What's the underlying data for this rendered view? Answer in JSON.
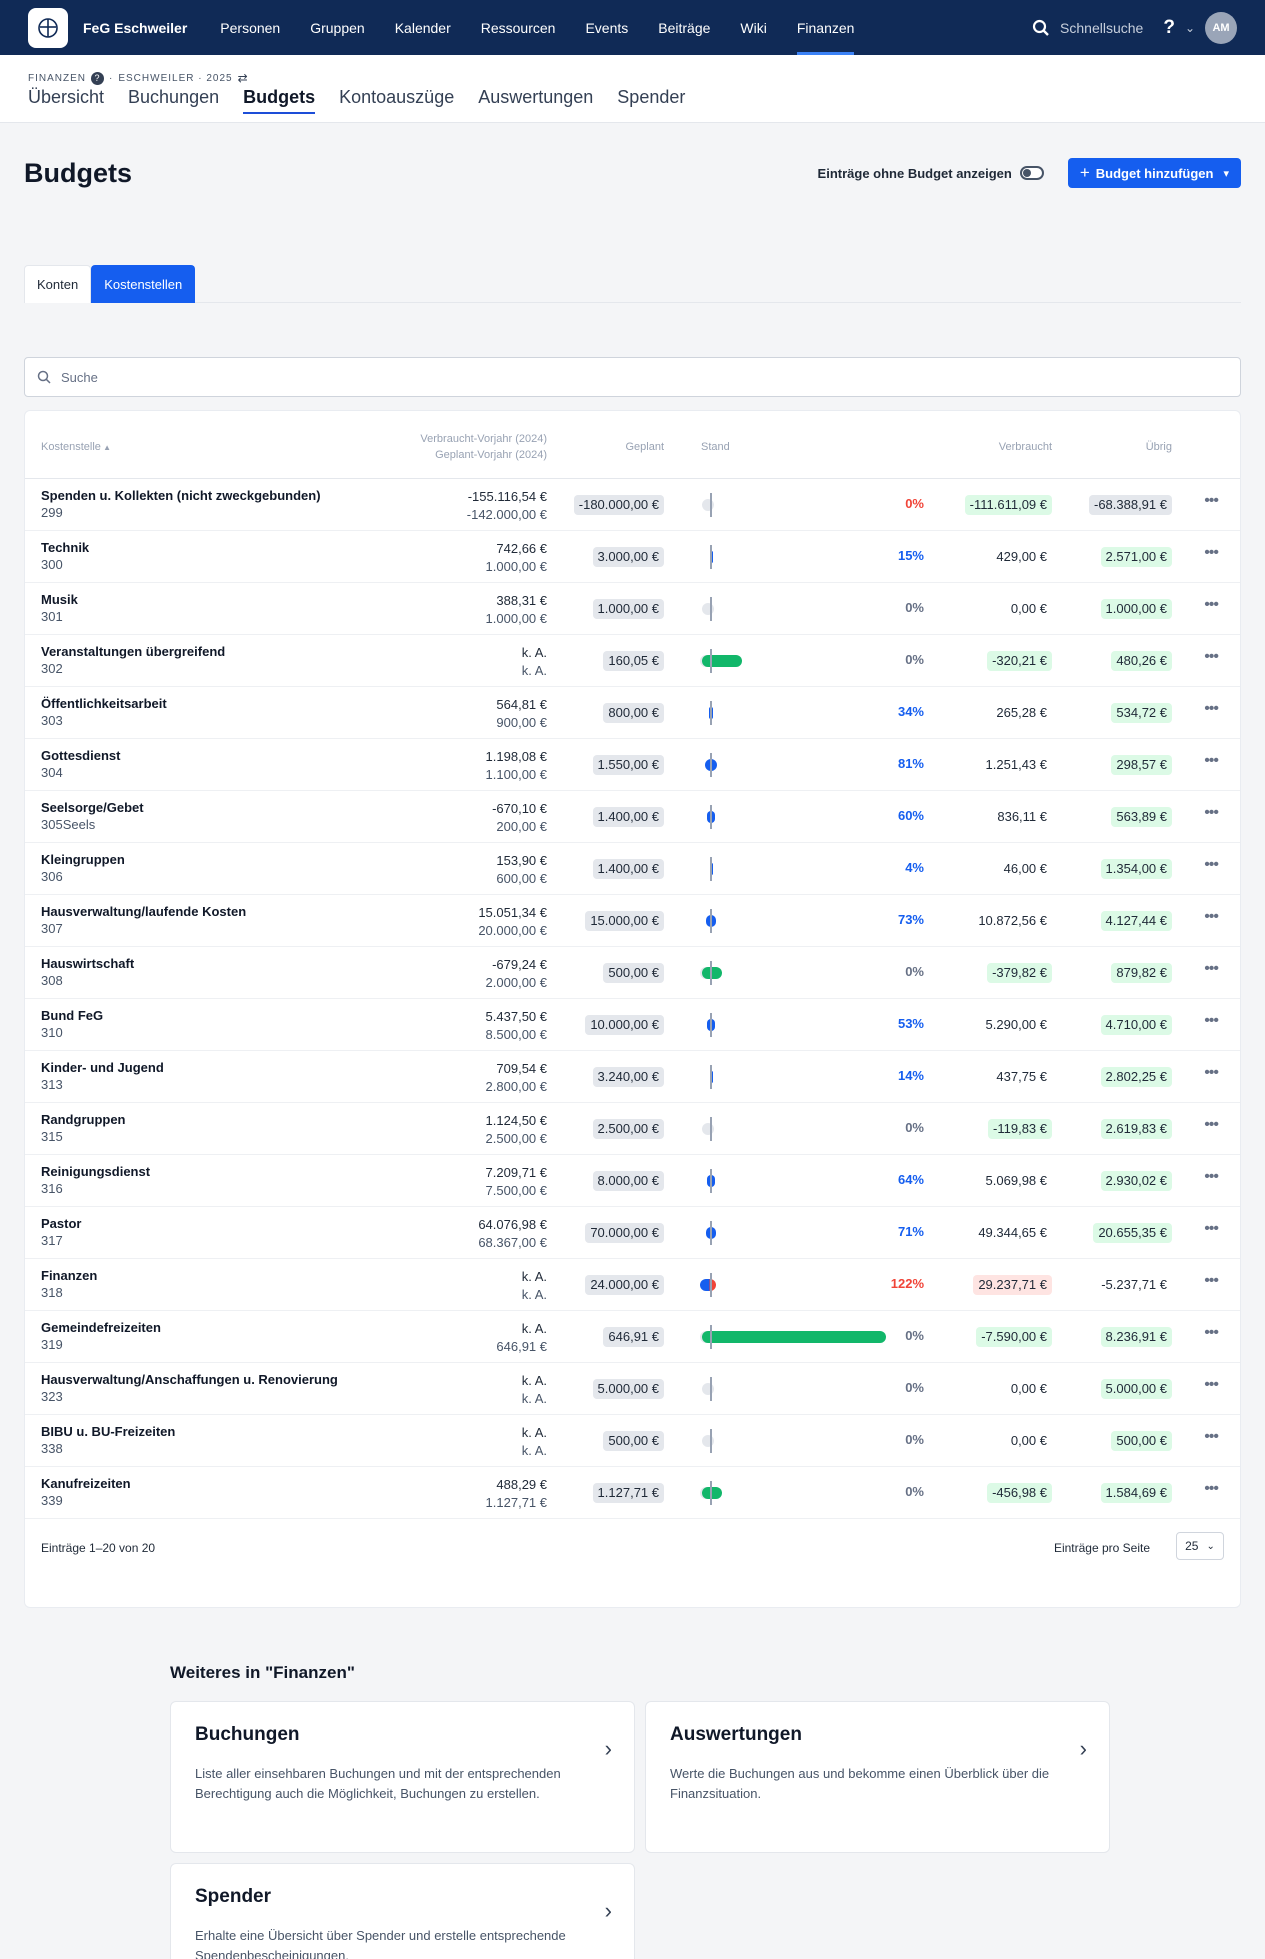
{
  "nav": {
    "brand": "FeG Eschweiler",
    "items": [
      "Personen",
      "Gruppen",
      "Kalender",
      "Ressourcen",
      "Events",
      "Beiträge",
      "Wiki",
      "Finanzen"
    ],
    "active": "Finanzen",
    "search_label": "Schnellsuche",
    "help": "?",
    "avatar": "AM"
  },
  "breadcrumb": {
    "section": "FINANZEN",
    "context": "ESCHWEILER · 2025"
  },
  "subtabs": [
    "Übersicht",
    "Buchungen",
    "Budgets",
    "Kontoauszüge",
    "Auswertungen",
    "Spender"
  ],
  "page": {
    "title": "Budgets",
    "toggle_label": "Einträge ohne Budget anzeigen",
    "add_button": "Budget hinzufügen"
  },
  "view_tabs": {
    "konten": "Konten",
    "kostenstellen": "Kostenstellen"
  },
  "search": {
    "placeholder": "Suche"
  },
  "table": {
    "headers": {
      "name": "Kostenstelle",
      "prev_used": "Verbraucht-Vorjahr (2024)",
      "prev_planned": "Geplant-Vorjahr (2024)",
      "planned": "Geplant",
      "status": "Stand",
      "used": "Verbraucht",
      "remaining": "Übrig"
    },
    "rows": [
      {
        "name": "Spenden u. Kollekten (nicht zweckgebunden)",
        "num": "299",
        "prev_used": "-155.116,54 €",
        "prev_planned": "-142.000,00 €",
        "planned": "-180.000,00 €",
        "pct": "0%",
        "pct_color": "red",
        "used": "-111.611,09 €",
        "used_style": "green",
        "rest": "-68.388,91 €",
        "rest_style": "gray",
        "bar": {
          "kind": "none",
          "value": 0
        }
      },
      {
        "name": "Technik",
        "num": "300",
        "prev_used": "742,66 €",
        "prev_planned": "1.000,00 €",
        "planned": "3.000,00 €",
        "pct": "15%",
        "pct_color": "blue",
        "used": "429,00 €",
        "used_style": "none",
        "rest": "2.571,00 €",
        "rest_style": "green",
        "bar": {
          "kind": "blue",
          "value": 0.15
        }
      },
      {
        "name": "Musik",
        "num": "301",
        "prev_used": "388,31 €",
        "prev_planned": "1.000,00 €",
        "planned": "1.000,00 €",
        "pct": "0%",
        "pct_color": "gray",
        "used": "0,00 €",
        "used_style": "none",
        "rest": "1.000,00 €",
        "rest_style": "green",
        "bar": {
          "kind": "none",
          "value": 0
        }
      },
      {
        "name": "Veranstaltungen übergreifend",
        "num": "302",
        "prev_used": "k. A.",
        "prev_planned": "k. A.",
        "planned": "160,05 €",
        "pct": "0%",
        "pct_color": "gray",
        "used": "-320,21 €",
        "used_style": "green",
        "rest": "480,26 €",
        "rest_style": "green",
        "bar": {
          "kind": "green",
          "value": 0.17
        }
      },
      {
        "name": "Öffentlichkeitsarbeit",
        "num": "303",
        "prev_used": "564,81 €",
        "prev_planned": "900,00 €",
        "planned": "800,00 €",
        "pct": "34%",
        "pct_color": "blue",
        "used": "265,28 €",
        "used_style": "none",
        "rest": "534,72 €",
        "rest_style": "green",
        "bar": {
          "kind": "blue",
          "value": 0.34
        }
      },
      {
        "name": "Gottesdienst",
        "num": "304",
        "prev_used": "1.198,08 €",
        "prev_planned": "1.100,00 €",
        "planned": "1.550,00 €",
        "pct": "81%",
        "pct_color": "blue",
        "used": "1.251,43 €",
        "used_style": "none",
        "rest": "298,57 €",
        "rest_style": "green",
        "bar": {
          "kind": "blue",
          "value": 0.81
        }
      },
      {
        "name": "Seelsorge/Gebet",
        "num": "305Seels",
        "prev_used": "-670,10 €",
        "prev_planned": "200,00 €",
        "planned": "1.400,00 €",
        "pct": "60%",
        "pct_color": "blue",
        "used": "836,11 €",
        "used_style": "none",
        "rest": "563,89 €",
        "rest_style": "green",
        "bar": {
          "kind": "blue",
          "value": 0.6
        }
      },
      {
        "name": "Kleingruppen",
        "num": "306",
        "prev_used": "153,90 €",
        "prev_planned": "600,00 €",
        "planned": "1.400,00 €",
        "pct": "4%",
        "pct_color": "blue",
        "used": "46,00 €",
        "used_style": "none",
        "rest": "1.354,00 €",
        "rest_style": "green",
        "bar": {
          "kind": "blue",
          "value": 0.04
        }
      },
      {
        "name": "Hausverwaltung/laufende Kosten",
        "num": "307",
        "prev_used": "15.051,34 €",
        "prev_planned": "20.000,00 €",
        "planned": "15.000,00 €",
        "pct": "73%",
        "pct_color": "blue",
        "used": "10.872,56 €",
        "used_style": "none",
        "rest": "4.127,44 €",
        "rest_style": "green",
        "bar": {
          "kind": "blue",
          "value": 0.73
        }
      },
      {
        "name": "Hauswirtschaft",
        "num": "308",
        "prev_used": "-679,24 €",
        "prev_planned": "2.000,00 €",
        "planned": "500,00 €",
        "pct": "0%",
        "pct_color": "gray",
        "used": "-379,82 €",
        "used_style": "green",
        "rest": "879,82 €",
        "rest_style": "green",
        "bar": {
          "kind": "green",
          "value": 0.06
        }
      },
      {
        "name": "Bund FeG",
        "num": "310",
        "prev_used": "5.437,50 €",
        "prev_planned": "8.500,00 €",
        "planned": "10.000,00 €",
        "pct": "53%",
        "pct_color": "blue",
        "used": "5.290,00 €",
        "used_style": "none",
        "rest": "4.710,00 €",
        "rest_style": "green",
        "bar": {
          "kind": "blue",
          "value": 0.53
        }
      },
      {
        "name": "Kinder- und Jugend",
        "num": "313",
        "prev_used": "709,54 €",
        "prev_planned": "2.800,00 €",
        "planned": "3.240,00 €",
        "pct": "14%",
        "pct_color": "blue",
        "used": "437,75 €",
        "used_style": "none",
        "rest": "2.802,25 €",
        "rest_style": "green",
        "bar": {
          "kind": "blue",
          "value": 0.14
        }
      },
      {
        "name": "Randgruppen",
        "num": "315",
        "prev_used": "1.124,50 €",
        "prev_planned": "2.500,00 €",
        "planned": "2.500,00 €",
        "pct": "0%",
        "pct_color": "gray",
        "used": "-119,83 €",
        "used_style": "green",
        "rest": "2.619,83 €",
        "rest_style": "green",
        "bar": {
          "kind": "none",
          "value": 0
        }
      },
      {
        "name": "Reinigungsdienst",
        "num": "316",
        "prev_used": "7.209,71 €",
        "prev_planned": "7.500,00 €",
        "planned": "8.000,00 €",
        "pct": "64%",
        "pct_color": "blue",
        "used": "5.069,98 €",
        "used_style": "none",
        "rest": "2.930,02 €",
        "rest_style": "green",
        "bar": {
          "kind": "blue",
          "value": 0.64
        }
      },
      {
        "name": "Pastor",
        "num": "317",
        "prev_used": "64.076,98 €",
        "prev_planned": "68.367,00 €",
        "planned": "70.000,00 €",
        "pct": "71%",
        "pct_color": "blue",
        "used": "49.344,65 €",
        "used_style": "none",
        "rest": "20.655,35 €",
        "rest_style": "green",
        "bar": {
          "kind": "blue",
          "value": 0.71
        }
      },
      {
        "name": "Finanzen",
        "num": "318",
        "prev_used": "k. A.",
        "prev_planned": "k. A.",
        "planned": "24.000,00 €",
        "pct": "122%",
        "pct_color": "red",
        "used": "29.237,71 €",
        "used_style": "red",
        "rest": "-5.237,71 €",
        "rest_style": "none",
        "bar": {
          "kind": "over",
          "value": 1.22
        }
      },
      {
        "name": "Gemeindefreizeiten",
        "num": "319",
        "prev_used": "k. A.",
        "prev_planned": "646,91 €",
        "planned": "646,91 €",
        "pct": "0%",
        "pct_color": "gray",
        "used": "-7.590,00 €",
        "used_style": "green",
        "rest": "8.236,91 €",
        "rest_style": "green",
        "bar": {
          "kind": "green",
          "value": 1.0
        }
      },
      {
        "name": "Hausverwaltung/Anschaffungen u. Renovierung",
        "num": "323",
        "prev_used": "k. A.",
        "prev_planned": "k. A.",
        "planned": "5.000,00 €",
        "pct": "0%",
        "pct_color": "gray",
        "used": "0,00 €",
        "used_style": "none",
        "rest": "5.000,00 €",
        "rest_style": "green",
        "bar": {
          "kind": "none",
          "value": 0
        }
      },
      {
        "name": "BIBU u. BU-Freizeiten",
        "num": "338",
        "prev_used": "k. A.",
        "prev_planned": "k. A.",
        "planned": "500,00 €",
        "pct": "0%",
        "pct_color": "gray",
        "used": "0,00 €",
        "used_style": "none",
        "rest": "500,00 €",
        "rest_style": "green",
        "bar": {
          "kind": "none",
          "value": 0
        }
      },
      {
        "name": "Kanufreizeiten",
        "num": "339",
        "prev_used": "488,29 €",
        "prev_planned": "1.127,71 €",
        "planned": "1.127,71 €",
        "pct": "0%",
        "pct_color": "gray",
        "used": "-456,98 €",
        "used_style": "green",
        "rest": "1.584,69 €",
        "rest_style": "green",
        "bar": {
          "kind": "green",
          "value": 0.04
        }
      }
    ],
    "footer": {
      "count": "Einträge 1–20 von 20",
      "per_page_label": "Einträge pro Seite",
      "per_page": "25"
    }
  },
  "more": {
    "heading": "Weiteres in \"Finanzen\"",
    "tiles": [
      {
        "title": "Buchungen",
        "desc": "Liste aller einsehbaren Buchungen und mit der entsprechenden Berechtigung auch die Möglichkeit, Buchungen zu erstellen."
      },
      {
        "title": "Auswertungen",
        "desc": "Werte die Buchungen aus und bekomme einen Überblick über die Finanzsituation."
      },
      {
        "title": "Spender",
        "desc": "Erhalte eine Übersicht über Spender und erstelle entsprechende Spendenbescheinigungen."
      }
    ]
  },
  "colors": {
    "nav_bg": "#102a56",
    "primary": "#155eef",
    "green": "#12b76a",
    "red": "#f04438",
    "blue": "#155eef"
  }
}
